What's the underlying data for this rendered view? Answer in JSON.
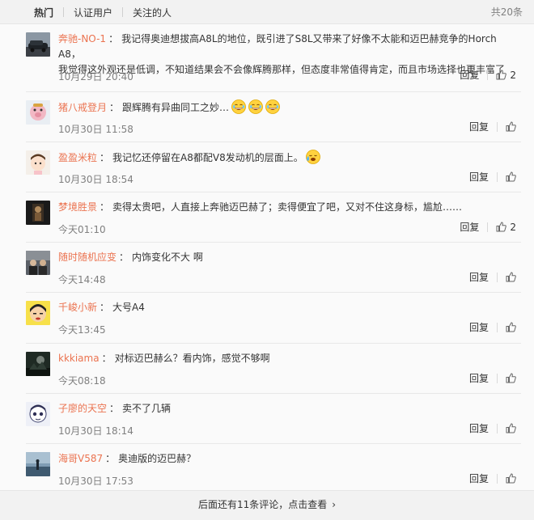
{
  "tabs": [
    "热门",
    "认证用户",
    "关注的人"
  ],
  "total_label": "共20条",
  "reply_label": "回复",
  "comments": [
    {
      "user": "奔驰-NO-1",
      "text_lines": [
        "我记得奥迪想拔高A8L的地位，既引进了S8L又带来了好像不太能和迈巴赫竞争的Horch A8，",
        "我觉得这外观还是低调，不知道结果会不会像辉腾那样，但态度非常值得肯定，而且市场选择也更丰富了"
      ],
      "time": "10月29日 20:40",
      "likes": "2",
      "emoji": []
    },
    {
      "user": "猪八戒登月",
      "text_lines": [
        "跟辉腾有异曲同工之妙…"
      ],
      "time": "10月30日 11:58",
      "likes": "",
      "emoji": [
        "laugh-emoji",
        "laugh-emoji",
        "laugh-emoji"
      ]
    },
    {
      "user": "盈盈米粒",
      "text_lines": [
        "我记忆还停留在A8都配V8发动机的层面上。"
      ],
      "time": "10月30日 18:54",
      "likes": "",
      "emoji": [
        "tears-emoji"
      ]
    },
    {
      "user": "梦境胜景",
      "text_lines": [
        "卖得太贵吧，人直接上奔驰迈巴赫了；卖得便宜了吧，又对不住这身标，尴尬……"
      ],
      "time": "今天01:10",
      "likes": "2",
      "emoji": []
    },
    {
      "user": "随时随机应变",
      "text_lines": [
        "内饰变化不大 啊"
      ],
      "time": "今天14:48",
      "likes": "",
      "emoji": []
    },
    {
      "user": "千峻小新",
      "text_lines": [
        "大号A4"
      ],
      "time": "今天13:45",
      "likes": "",
      "emoji": []
    },
    {
      "user": "kkkiama",
      "text_lines": [
        "对标迈巴赫么？看内饰，感觉不够啊"
      ],
      "time": "今天08:18",
      "likes": "",
      "emoji": []
    },
    {
      "user": "子廖的天空",
      "text_lines": [
        "卖不了几辆"
      ],
      "time": "10月30日 18:14",
      "likes": "",
      "emoji": []
    },
    {
      "user": "海哥V587",
      "text_lines": [
        "奥迪版的迈巴赫？"
      ],
      "time": "10月30日 17:53",
      "likes": "",
      "emoji": []
    }
  ],
  "footer": {
    "more_label": "后面还有11条评论，点击查看",
    "arrow": "›"
  }
}
